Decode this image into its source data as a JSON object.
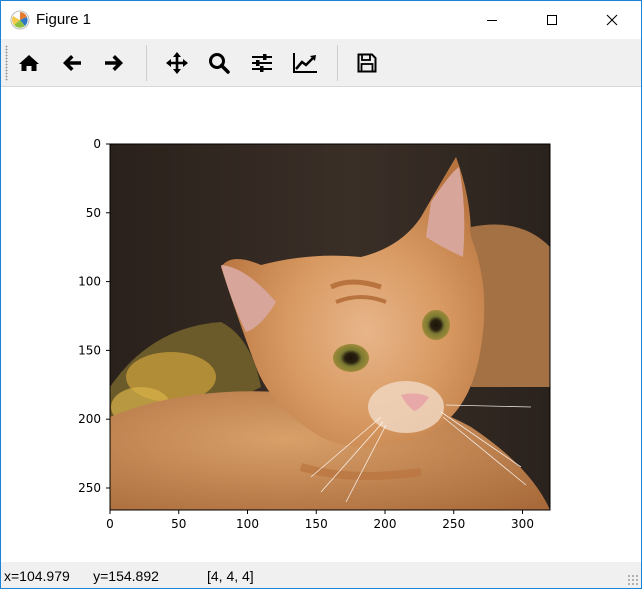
{
  "window": {
    "title": "Figure 1"
  },
  "toolbar": {
    "buttons": [
      {
        "name": "home-button",
        "icon": "home-icon"
      },
      {
        "name": "back-button",
        "icon": "arrow-left-icon"
      },
      {
        "name": "forward-button",
        "icon": "arrow-right-icon"
      },
      {
        "name": "pan-button",
        "icon": "move-icon"
      },
      {
        "name": "zoom-button",
        "icon": "magnifier-icon"
      },
      {
        "name": "subplots-button",
        "icon": "sliders-icon"
      },
      {
        "name": "axes-edit-button",
        "icon": "line-chart-icon"
      },
      {
        "name": "save-button",
        "icon": "floppy-disk-icon"
      }
    ]
  },
  "chart_data": {
    "type": "image",
    "image_description_hidden": false,
    "x_ticks": [
      0,
      50,
      100,
      150,
      200,
      250,
      300
    ],
    "y_ticks": [
      0,
      50,
      100,
      150,
      200,
      250
    ],
    "xlim": [
      0,
      320
    ],
    "ylim": [
      266,
      0
    ]
  },
  "status": {
    "coords": "x=104.979      y=154.892",
    "pixel_value": "[4, 4, 4]"
  },
  "colors": {
    "accent_border": "#1883d7",
    "toolbar_bg": "#f0f0f0"
  }
}
